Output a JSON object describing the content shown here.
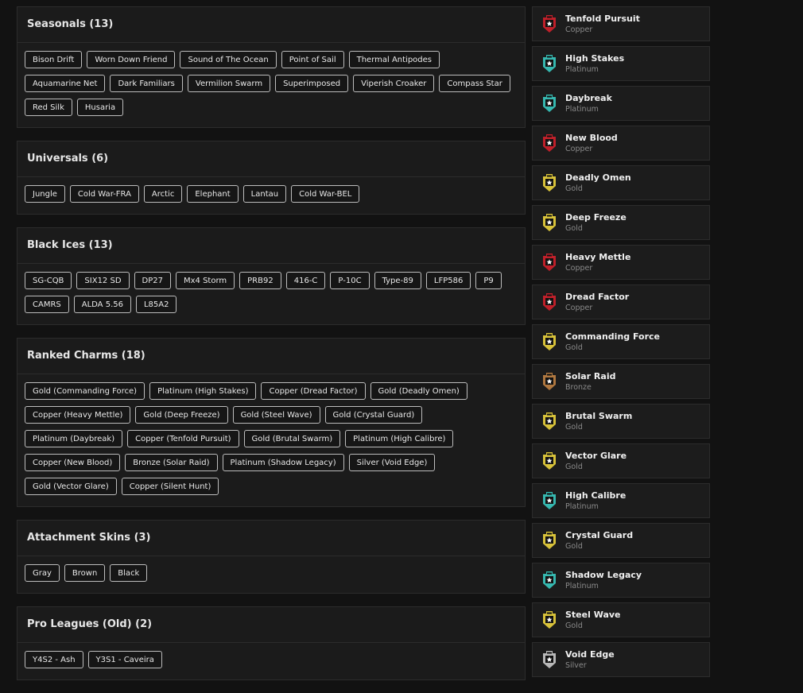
{
  "sections": [
    {
      "title": "Seasonals (13)",
      "items": [
        "Bison Drift",
        "Worn Down Friend",
        "Sound of The Ocean",
        "Point of Sail",
        "Thermal Antipodes",
        "Aquamarine Net",
        "Dark Familiars",
        "Vermilion Swarm",
        "Superimposed",
        "Viperish Croaker",
        "Compass Star",
        "Red Silk",
        "Husaria"
      ]
    },
    {
      "title": "Universals (6)",
      "items": [
        "Jungle",
        "Cold War-FRA",
        "Arctic",
        "Elephant",
        "Lantau",
        "Cold War-BEL"
      ]
    },
    {
      "title": "Black Ices (13)",
      "items": [
        "SG-CQB",
        "SIX12 SD",
        "DP27",
        "Mx4 Storm",
        "PRB92",
        "416-C",
        "P-10C",
        "Type-89",
        "LFP586",
        "P9",
        "CAMRS",
        "ALDA 5.56",
        "L85A2"
      ]
    },
    {
      "title": "Ranked Charms (18)",
      "items": [
        "Gold (Commanding Force)",
        "Platinum (High Stakes)",
        "Copper (Dread Factor)",
        "Gold (Deadly Omen)",
        "Copper (Heavy Mettle)",
        "Gold (Deep Freeze)",
        "Gold (Steel Wave)",
        "Gold (Crystal Guard)",
        "Platinum (Daybreak)",
        "Copper (Tenfold Pursuit)",
        "Gold (Brutal Swarm)",
        "Platinum (High Calibre)",
        "Copper (New Blood)",
        "Bronze (Solar Raid)",
        "Platinum (Shadow Legacy)",
        "Silver (Void Edge)",
        "Gold (Vector Glare)",
        "Copper (Silent Hunt)"
      ]
    },
    {
      "title": "Attachment Skins (3)",
      "items": [
        "Gray",
        "Brown",
        "Black"
      ]
    },
    {
      "title": "Pro Leagues (Old) (2)",
      "items": [
        "Y4S2 - Ash",
        "Y3S1 - Caveira"
      ]
    }
  ],
  "tier_colors": {
    "Copper": "#c0202a",
    "Platinum": "#36b8b0",
    "Gold": "#d8c23a",
    "Bronze": "#b07840",
    "Silver": "#b8b8b8"
  },
  "ranks": [
    {
      "name": "Tenfold Pursuit",
      "tier": "Copper",
      "icon": "rank-badge-icon"
    },
    {
      "name": "High Stakes",
      "tier": "Platinum",
      "icon": "rank-badge-icon"
    },
    {
      "name": "Daybreak",
      "tier": "Platinum",
      "icon": "rank-badge-icon"
    },
    {
      "name": "New Blood",
      "tier": "Copper",
      "icon": "rank-badge-icon"
    },
    {
      "name": "Deadly Omen",
      "tier": "Gold",
      "icon": "rank-badge-icon"
    },
    {
      "name": "Deep Freeze",
      "tier": "Gold",
      "icon": "rank-badge-icon"
    },
    {
      "name": "Heavy Mettle",
      "tier": "Copper",
      "icon": "rank-badge-icon"
    },
    {
      "name": "Dread Factor",
      "tier": "Copper",
      "icon": "rank-badge-icon"
    },
    {
      "name": "Commanding Force",
      "tier": "Gold",
      "icon": "rank-badge-icon"
    },
    {
      "name": "Solar Raid",
      "tier": "Bronze",
      "icon": "rank-badge-icon"
    },
    {
      "name": "Brutal Swarm",
      "tier": "Gold",
      "icon": "rank-badge-icon"
    },
    {
      "name": "Vector Glare",
      "tier": "Gold",
      "icon": "rank-badge-icon"
    },
    {
      "name": "High Calibre",
      "tier": "Platinum",
      "icon": "rank-badge-icon"
    },
    {
      "name": "Crystal Guard",
      "tier": "Gold",
      "icon": "rank-badge-icon"
    },
    {
      "name": "Shadow Legacy",
      "tier": "Platinum",
      "icon": "rank-badge-icon"
    },
    {
      "name": "Steel Wave",
      "tier": "Gold",
      "icon": "rank-badge-icon"
    },
    {
      "name": "Void Edge",
      "tier": "Silver",
      "icon": "rank-badge-icon"
    }
  ]
}
